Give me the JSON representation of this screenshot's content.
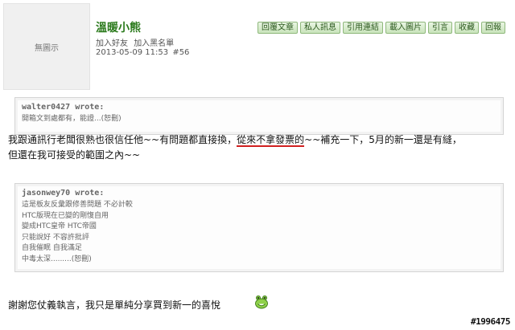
{
  "avatar": {
    "label": "無圖示"
  },
  "user": {
    "name": "溫暖小熊",
    "add_friend": "加入好友",
    "add_blacklist": "加入黑名單"
  },
  "meta": {
    "datetime": "2013-05-09 11:53",
    "post_no": "#56"
  },
  "toolbar": [
    "回覆文章",
    "私人訊息",
    "引用連結",
    "載入圖片",
    "引言",
    "收藏",
    "回報"
  ],
  "quote1": {
    "author": "walter0427 wrote:",
    "lines": [
      "開箱文到處都有，能證...(恕刪)"
    ]
  },
  "para1": {
    "before": "我跟通訊行老闆很熟也很信任他~~有問題都直接換，",
    "underlined": "從來不拿發票的",
    "after": "~~補充一下，5月的新一還是有縫，",
    "line2": "但還在我可接受的範圍之內~~"
  },
  "quote2": {
    "author": "jasonwey70 wrote:",
    "lines": [
      "這是板友反彙跟修善問題 不必計較",
      "HTC版現在已變的剛愎自用",
      "變成HTC皇帝 HTC帝國",
      "只能說好 不容許批評",
      "自我催眠 自我滿足",
      "中毒太深.........(恕刪)"
    ]
  },
  "para2": {
    "text": "謝謝您仗義執言，我只是單純分享買到新一的喜悅"
  },
  "watermark": "#1996475",
  "icons": {
    "smiley": "smiley-icon"
  }
}
